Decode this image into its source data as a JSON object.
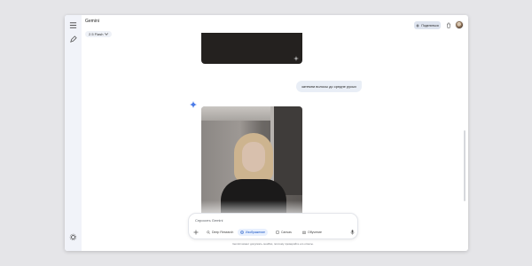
{
  "app": {
    "title": "Gemini",
    "model": "2.5 Flash"
  },
  "header": {
    "share_label": "Поделиться"
  },
  "conversation": {
    "user_message": "затемни волосы до средне русых"
  },
  "input": {
    "placeholder": "Спросить Gemini",
    "tools": [
      {
        "label": "Deep Research",
        "icon": "deep-research-icon"
      },
      {
        "label": "Изображение",
        "icon": "image-icon",
        "active": true
      },
      {
        "label": "Canvas",
        "icon": "canvas-icon"
      },
      {
        "label": "Обучение",
        "icon": "learning-icon"
      }
    ]
  },
  "footer": {
    "disclaimer": "Gemini может допускать ошибки, поэтому проверяйте его ответы."
  },
  "colors": {
    "accent": "#1a56c4",
    "rail": "#f1f3f9",
    "bubble": "#e9eef6"
  }
}
